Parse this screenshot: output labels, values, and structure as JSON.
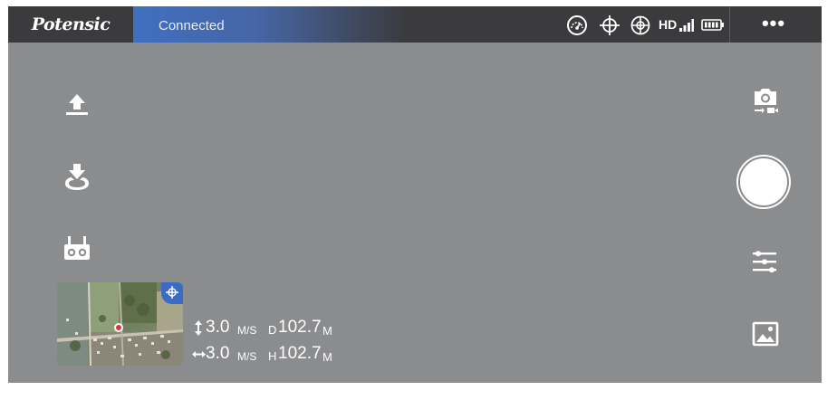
{
  "topbar": {
    "logo_text": "Potensic",
    "connection_status": "Connected",
    "icons": [
      "gauge-icon",
      "gps-crosshair-icon",
      "home-point-icon"
    ],
    "video_link": "HD",
    "menu_label": "•••"
  },
  "left_toolbar": {
    "icons": [
      "takeoff-icon",
      "land-icon",
      "remote-controller-icon"
    ]
  },
  "right_toolbar": {
    "icons": [
      "camera-switch-icon",
      "shutter-button",
      "settings-sliders-icon",
      "gallery-icon"
    ]
  },
  "telemetry": {
    "vertical_speed": "3.0",
    "vertical_speed_unit": "M/S",
    "distance_label": "D",
    "distance_value": "102.7",
    "distance_unit": "M",
    "horizontal_speed": "3.0",
    "horizontal_speed_unit": "M/S",
    "height_label": "H",
    "height_value": "102.7",
    "height_unit": "M"
  },
  "colors": {
    "background": "#8b8c8e",
    "topbar": "#3b3b3d",
    "status_accent": "#3f6fc0",
    "map_marker": "#e2303a"
  }
}
